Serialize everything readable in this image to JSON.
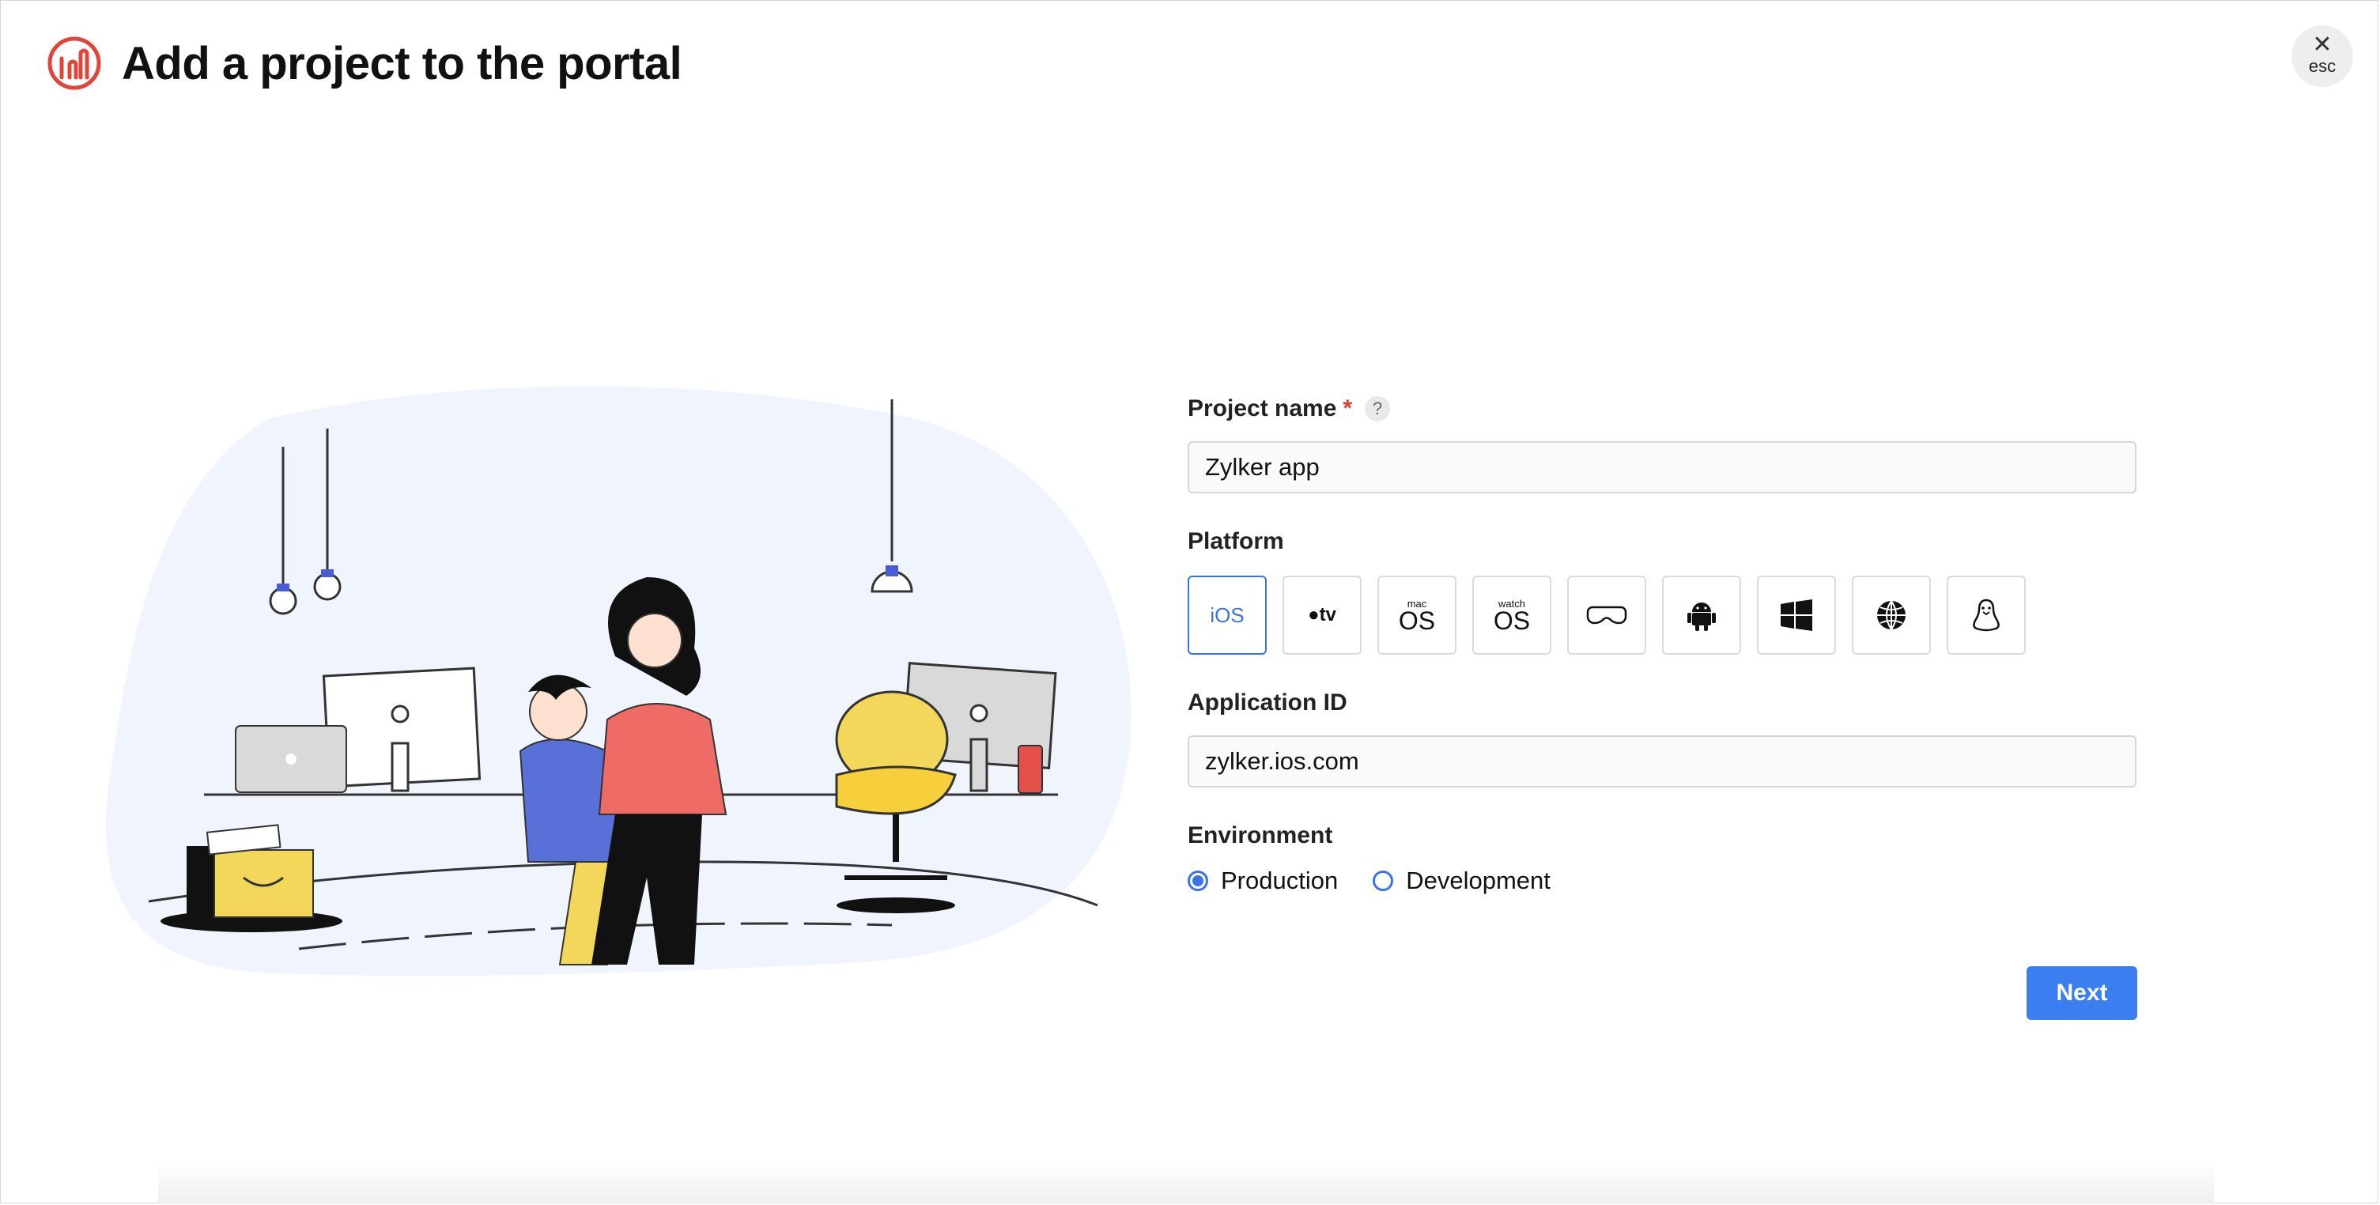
{
  "header": {
    "title": "Add a project to the portal"
  },
  "close": {
    "icon": "close-icon",
    "label": "esc"
  },
  "form": {
    "project_name": {
      "label": "Project name",
      "required_mark": "*",
      "help_mark": "?",
      "value": "Zylker app"
    },
    "platform": {
      "label": "Platform",
      "selected": "iOS",
      "options": [
        {
          "name": "iOS",
          "text": "iOS",
          "icon": "ios-text"
        },
        {
          "name": "tvOS",
          "text": "tv",
          "icon": "apple-tv-icon"
        },
        {
          "name": "macOS",
          "top": "mac",
          "bottom": "OS",
          "icon": "macos-icon"
        },
        {
          "name": "watchOS",
          "top": "watch",
          "bottom": "OS",
          "icon": "watchos-icon"
        },
        {
          "name": "visionOS",
          "icon": "vision-headset-icon"
        },
        {
          "name": "Android",
          "icon": "android-icon"
        },
        {
          "name": "Windows",
          "icon": "windows-icon"
        },
        {
          "name": "Web",
          "icon": "globe-icon"
        },
        {
          "name": "Linux",
          "icon": "linux-penguin-icon"
        }
      ]
    },
    "application_id": {
      "label": "Application ID",
      "value": "zylker.ios.com"
    },
    "environment": {
      "label": "Environment",
      "options": [
        {
          "label": "Production",
          "selected": true
        },
        {
          "label": "Development",
          "selected": false
        }
      ]
    }
  },
  "actions": {
    "next_label": "Next"
  },
  "colors": {
    "accent": "#3b7ef0",
    "logo": "#e0453a",
    "required": "#e23b3b"
  }
}
